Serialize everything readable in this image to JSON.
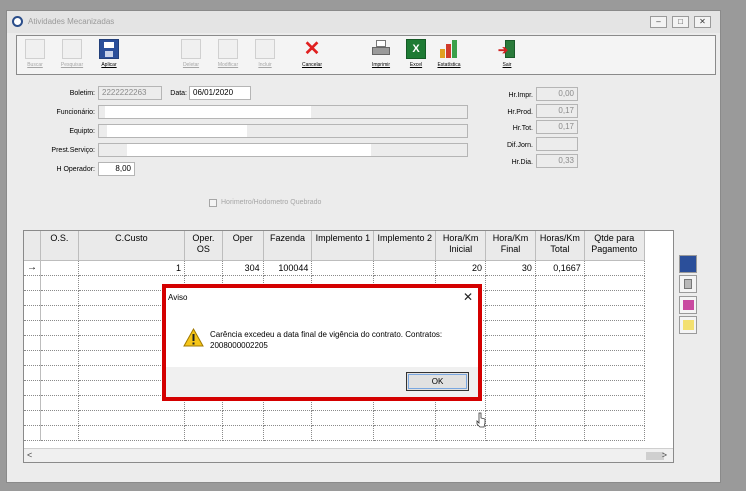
{
  "window": {
    "title": "Atividades Mecanizadas",
    "minimize": "–",
    "maximize": "□",
    "close": "✕"
  },
  "toolbar": {
    "buscar": "Buscar",
    "pesquisar": "Pesquisar",
    "aplicar": "Aplicar",
    "deletar": "Deletar",
    "modificar": "Modificar",
    "incluir": "Incluir",
    "cancelar": "Cancelar",
    "imprimir": "Imprimir",
    "excel": "Excel",
    "estatistica": "Estatística",
    "sair": "Sair"
  },
  "form": {
    "boletim_label": "Boletim:",
    "boletim_value": "2222222263",
    "data_label": "Data:",
    "data_value": "06/01/2020",
    "funcionario_label": "Funcionário:",
    "equipto_label": "Equipto:",
    "prest_label": "Prest.Serviço:",
    "operador_label": "H Operador:",
    "operador_value": "8,00",
    "horimetro_label": "Horimetro/Hodometro Quebrado",
    "hr_impr_label": "Hr.Impr.",
    "hr_impr_value": "0,00",
    "hr_prod_label": "Hr.Prod.",
    "hr_prod_value": "0,17",
    "hr_tot_label": "Hr.Tot.",
    "hr_tot_value": "0,17",
    "dif_jorn_label": "Dif.Jorn.",
    "dif_jorn_value": "",
    "hr_dia_label": "Hr.Dia.",
    "hr_dia_value": "0,33"
  },
  "grid": {
    "columns": [
      "O.S.",
      "C.Custo",
      "Oper. OS",
      "Oper",
      "Fazenda",
      "Implemento 1",
      "Implemento 2",
      "Hora/Km Inicial",
      "Hora/Km Final",
      "Horas/Km Total",
      "Qtde para Pagamento"
    ],
    "row1": {
      "indicator": "→",
      "os": "",
      "ccusto": "1",
      "oper_os": "",
      "oper": "304",
      "fazenda": "100044",
      "impl1": "",
      "impl2": "",
      "inicial": "20",
      "final": "30",
      "total": "0,1667",
      "qtde": ""
    }
  },
  "dialog": {
    "title": "Aviso",
    "close": "✕",
    "message_line1": "Carência excedeu a data final de vigência do contrato. Contratos:",
    "message_line2": "2008000002205",
    "ok": "OK"
  },
  "icons": {
    "toolbar": [
      "buscar-icon",
      "pesquisar-icon",
      "save-icon",
      "deletar-icon",
      "modificar-icon",
      "incluir-icon",
      "cancel-x-icon",
      "printer-icon",
      "excel-icon",
      "chart-icon",
      "exit-door-icon"
    ],
    "warning": "warning-triangle-icon"
  },
  "colors": {
    "highlight_border": "#d40000",
    "cancel_red": "#e02020",
    "excel_green": "#1e7b34"
  }
}
